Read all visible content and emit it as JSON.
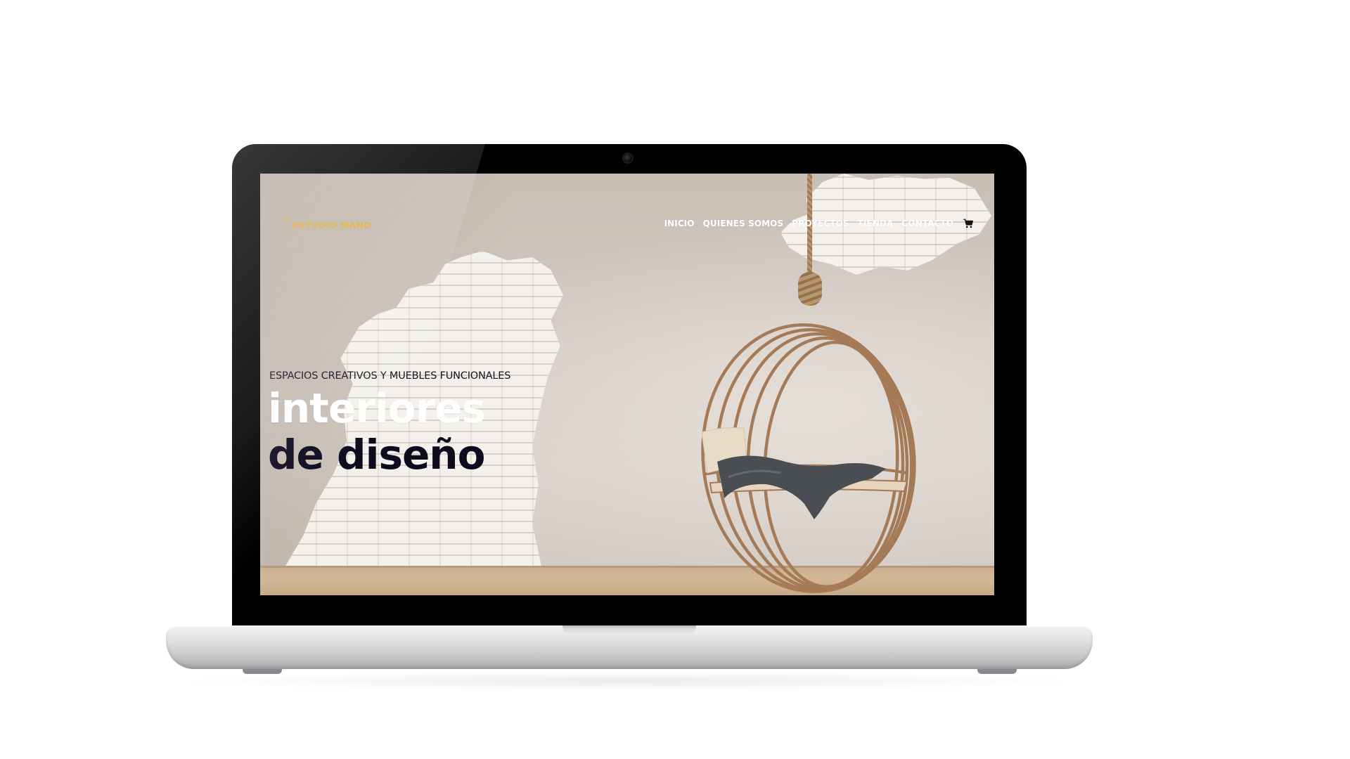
{
  "site": {
    "logo_text": "ESTUDIO MANO",
    "accent_color": "#e0ad3a"
  },
  "nav": {
    "items": [
      {
        "label": "INICIO"
      },
      {
        "label": "QUIENES SOMOS"
      },
      {
        "label": "PROYECTOS"
      },
      {
        "label": "TIENDA"
      },
      {
        "label": "CONTACTO"
      }
    ],
    "cart_icon": "cart-icon"
  },
  "hero": {
    "subtitle": "ESPACIOS CREATIVOS Y MUEBLES FUNCIONALES",
    "headline_line1": "interiores",
    "headline_line2": "de diseño",
    "line1_color": "#ffffff",
    "line2_color": "#0f0b1f"
  },
  "device": {
    "type": "laptop",
    "camera_icon": "webcam-icon"
  }
}
